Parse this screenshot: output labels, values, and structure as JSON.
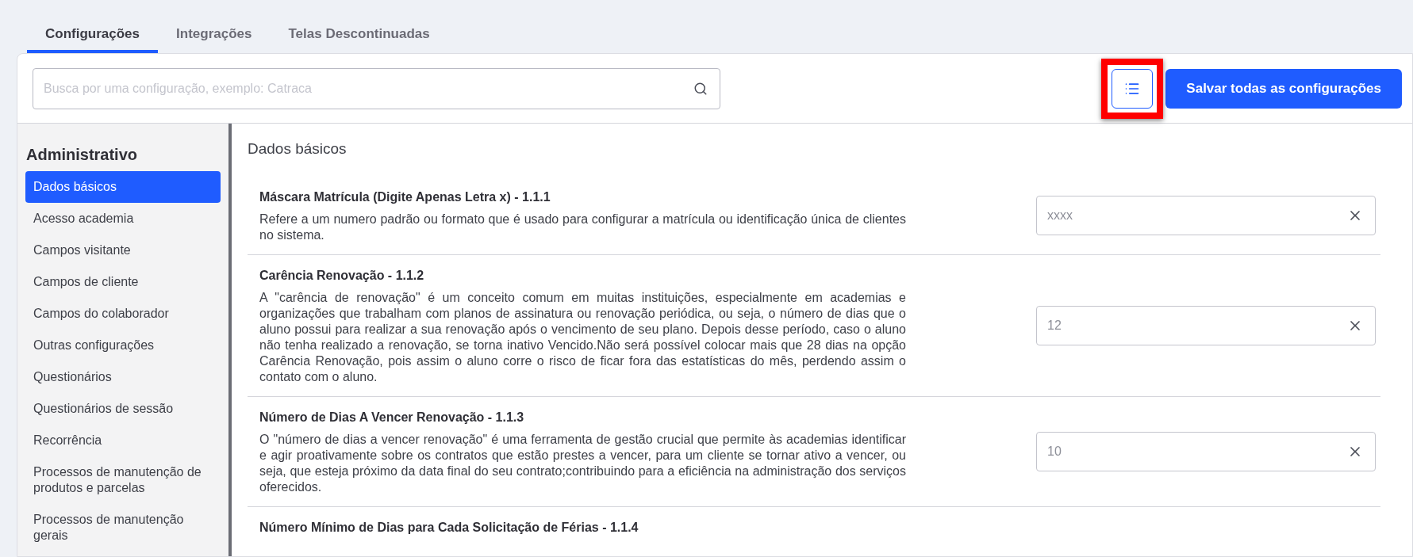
{
  "tabs": [
    {
      "label": "Configurações",
      "selected": true
    },
    {
      "label": "Integrações",
      "selected": false
    },
    {
      "label": "Telas Descontinuadas",
      "selected": false
    }
  ],
  "search": {
    "placeholder": "Busca por uma configuração, exemplo: Catraca"
  },
  "list_button": {
    "highlighted": true
  },
  "save_button": "Salvar todas as configurações",
  "sidebar": {
    "title": "Administrativo",
    "items": [
      {
        "label": "Dados básicos",
        "selected": true
      },
      {
        "label": "Acesso academia",
        "selected": false
      },
      {
        "label": "Campos visitante",
        "selected": false
      },
      {
        "label": "Campos de cliente",
        "selected": false
      },
      {
        "label": "Campos do colaborador",
        "selected": false
      },
      {
        "label": "Outras configurações",
        "selected": false
      },
      {
        "label": "Questionários",
        "selected": false
      },
      {
        "label": "Questionários de sessão",
        "selected": false
      },
      {
        "label": "Recorrência",
        "selected": false
      },
      {
        "label": "Processos de manutenção de produtos e parcelas",
        "selected": false
      },
      {
        "label": "Processos de manutenção gerais",
        "selected": false
      }
    ]
  },
  "section_title": "Dados básicos",
  "settings": [
    {
      "title": "Máscara Matrícula (Digite Apenas Letra x) - 1.1.1",
      "description": "Refere a um numero padrão ou formato que é usado para configurar a matrícula ou identificação única de clientes no sistema.",
      "placeholder": "xxxx"
    },
    {
      "title": "Carência Renovação - 1.1.2",
      "description": "A \"carência de renovação\" é um conceito comum em muitas instituições, especialmente em academias e organizações que trabalham com planos de assinatura ou renovação periódica, ou seja, o número de dias que o aluno possui para realizar a sua renovação após o vencimento de seu plano. Depois desse período, caso o aluno não tenha realizado a renovação, se torna inativo Vencido.Não será possível colocar mais que 28 dias na opção Carência Renovação, pois assim o aluno corre o risco de ficar fora das estatísticas do mês, perdendo assim o contato com o aluno.",
      "placeholder": "12"
    },
    {
      "title": "Número de Dias A Vencer Renovação - 1.1.3",
      "description": "O \"número de dias a vencer renovação\" é uma ferramenta de gestão crucial que permite às academias identificar e agir proativamente sobre os contratos que estão prestes a vencer, para um cliente se tornar ativo a vencer, ou seja, que esteja próximo da data final do seu contrato;contribuindo para a eficiência na administração dos serviços oferecidos.",
      "placeholder": "10"
    },
    {
      "title": "Número Mínimo de Dias para Cada Solicitação de Férias - 1.1.4"
    }
  ]
}
